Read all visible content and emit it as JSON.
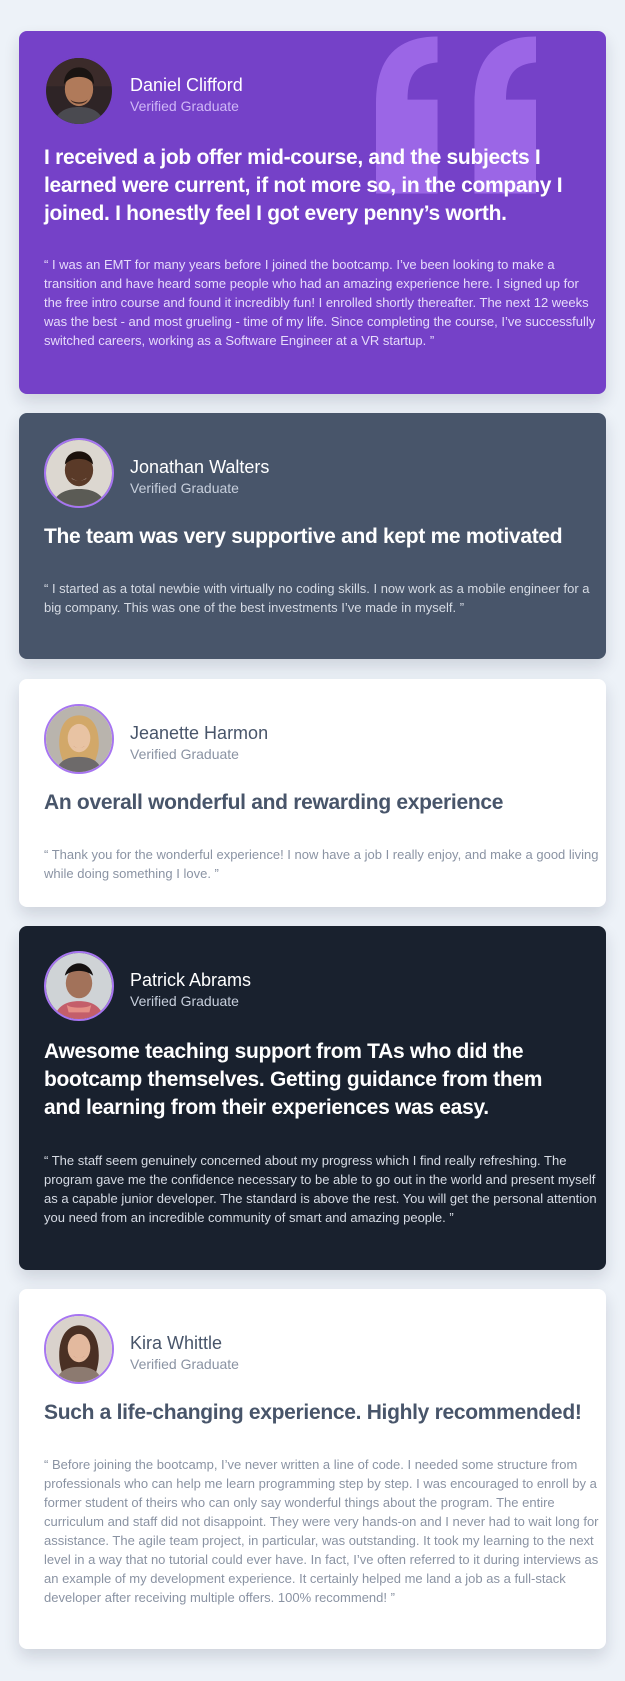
{
  "colors": {
    "page_background": "#edf2f8",
    "purple": "#7541c8",
    "grayish_blue": "#48556a",
    "dark_blackish_blue": "#19212e",
    "white": "#ffffff",
    "light_violet": "#a775f1"
  },
  "icons": {
    "quotation": "quotation-mark-icon"
  },
  "testimonials": [
    {
      "name": "Daniel Clifford",
      "role": "Verified Graduate",
      "headline": "I received a job offer mid-course, and the subjects I learned were current, if not more so, in the company I joined. I honestly feel I got every penny’s worth.",
      "body": "“ I was an EMT for many years before I joined the bootcamp. I’ve been looking to make a transition and have heard some people who had an amazing experience here. I signed up for the free intro course and found it incredibly fun! I enrolled shortly thereafter. The next 12 weeks was the best - and most grueling - time of my life. Since completing the course, I’ve successfully switched careers, working as a Software Engineer at a VR startup. ”"
    },
    {
      "name": "Jonathan Walters",
      "role": "Verified Graduate",
      "headline": "The team was very supportive and kept me motivated",
      "body": "“ I started as a total newbie with virtually no coding skills. I now work as a mobile engineer for a big company. This was one of the best investments I’ve made in myself. ”"
    },
    {
      "name": "Jeanette Harmon",
      "role": "Verified Graduate",
      "headline": "An overall wonderful and rewarding experience",
      "body": "“ Thank you for the wonderful experience! I now have a job I really enjoy, and make a good living while doing something I love. ”"
    },
    {
      "name": "Patrick Abrams",
      "role": "Verified Graduate",
      "headline": "Awesome teaching support from TAs who did the bootcamp themselves. Getting guidance from them and learning from their experiences was easy.",
      "body": "“ The staff seem genuinely concerned about my progress which I find really refreshing. The program gave me the confidence necessary to be able to go out in the world and present myself as a capable junior developer. The standard is above the rest. You will get the personal attention you need from an incredible community of smart and amazing people. ”"
    },
    {
      "name": "Kira Whittle",
      "role": "Verified Graduate",
      "headline": "Such a life-changing experience. Highly recommended!",
      "body": "“ Before joining the bootcamp, I’ve never written a line of code. I needed some structure from professionals who can help me learn programming step by step. I was encouraged to enroll by a former student of theirs who can only say wonderful things about the program. The entire curriculum and staff did not disappoint. They were very hands-on and I never had to wait long for assistance. The agile team project, in particular, was outstanding. It took my learning to the next level in a way that no tutorial could ever have. In fact, I’ve often referred to it during interviews as an example of my development experience. It certainly helped me land a job as a full-stack developer after receiving multiple offers. 100% recommend! ”"
    }
  ]
}
